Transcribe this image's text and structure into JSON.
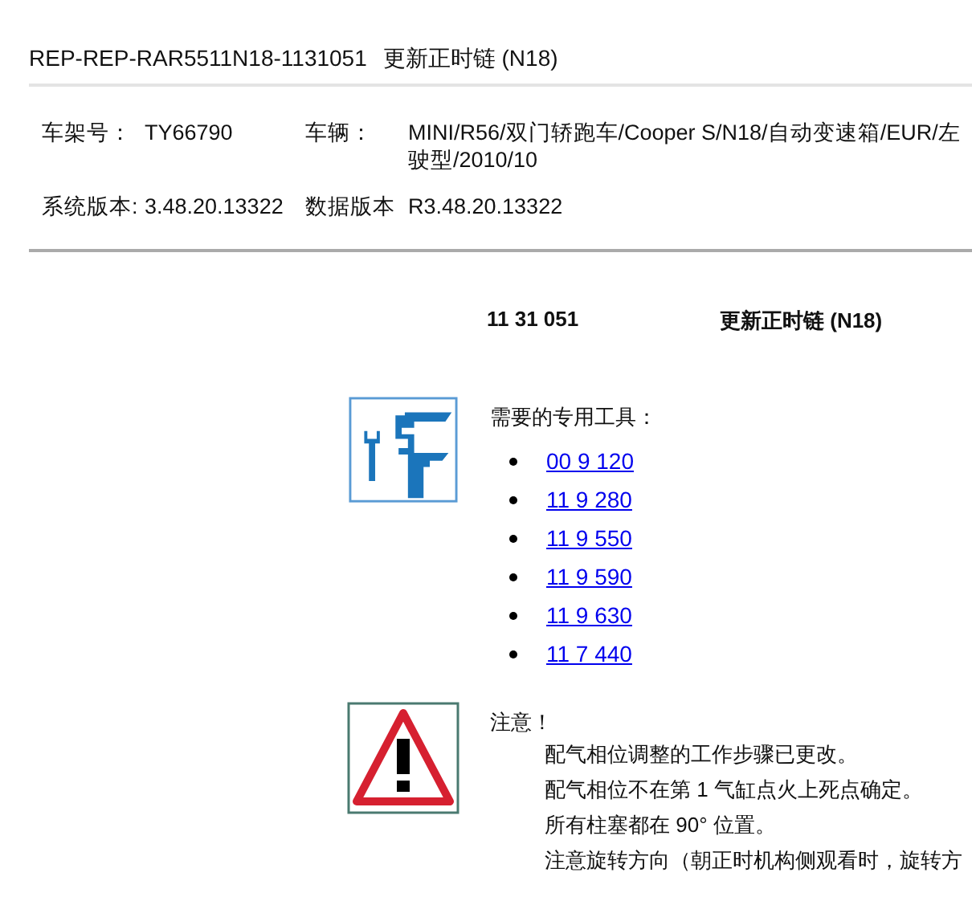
{
  "header": {
    "code": "REP-REP-RAR5511N18-1131051",
    "title": "更新正时链 (N18)"
  },
  "info": [
    {
      "label": "车架号：",
      "value": "TY66790",
      "label2": "车辆：",
      "value2": [
        "MINI/R56/双门轿跑车/Cooper S/N18/自动变速箱/EUR/左",
        "驶型/2010/10"
      ]
    },
    {
      "label": "系统版本:",
      "value": "3.48.20.13322",
      "label2": "数据版本",
      "value2": [
        "R3.48.20.13322"
      ]
    }
  ],
  "procedure": {
    "number": "11 31 051",
    "title": "更新正时链 (N18)"
  },
  "tools": {
    "heading": "需要的专用工具：",
    "items": [
      "00 9 120",
      "11 9 280",
      "11 9 550",
      "11 9 590",
      "11 9 630",
      "11 7 440"
    ]
  },
  "caution": {
    "heading": "注意！",
    "lines": [
      "配气相位调整的工作步骤已更改。",
      "配气相位不在第 1 气缸点火上死点确定。",
      "所有柱塞都在 90° 位置。",
      "注意旋转方向（朝正时机构侧观看时，旋转方"
    ]
  }
}
